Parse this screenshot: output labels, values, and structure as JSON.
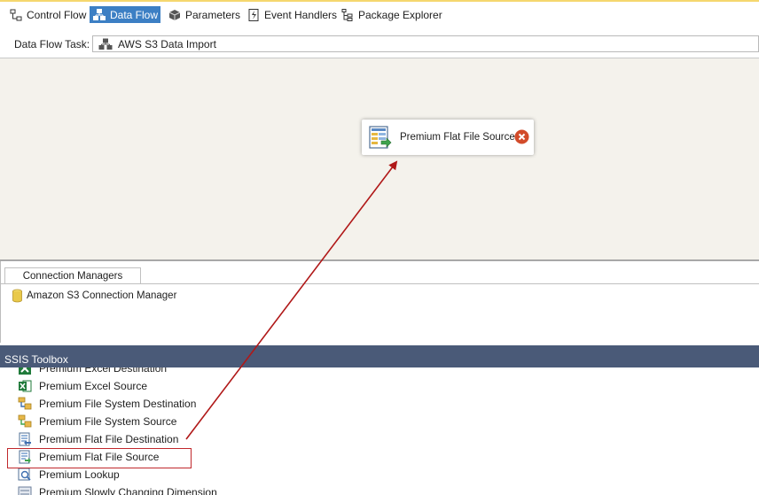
{
  "tabs": [
    {
      "label": "Control Flow",
      "icon": "control-flow-icon",
      "active": false
    },
    {
      "label": "Data Flow",
      "icon": "data-flow-icon",
      "active": true
    },
    {
      "label": "Parameters",
      "icon": "parameters-icon",
      "active": false
    },
    {
      "label": "Event Handlers",
      "icon": "event-handlers-icon",
      "active": false
    },
    {
      "label": "Package Explorer",
      "icon": "package-explorer-icon",
      "active": false
    }
  ],
  "task": {
    "label": "Data Flow Task:",
    "value": "AWS S3 Data Import"
  },
  "canvas": {
    "component_label": "Premium Flat File Source",
    "component_icon": "flat-file-source-icon",
    "error_icon": "error-icon"
  },
  "connection_managers": {
    "tab_label": "Connection Managers",
    "items": [
      "Amazon S3 Connection Manager"
    ]
  },
  "toolbox": {
    "title": "SSIS Toolbox",
    "items": [
      "Premium Excel Destination",
      "Premium Excel Source",
      "Premium File System Destination",
      "Premium File System Source",
      "Premium Flat File Destination",
      "Premium Flat File Source",
      "Premium Lookup",
      "Premium Slowly Changing Dimension"
    ],
    "highlighted": "Premium Flat File Source"
  },
  "colors": {
    "accent": "#3c7fc4",
    "toolbox_header": "#4a5a78",
    "canvas_bg": "#f4f2ec",
    "arrow": "#b01818"
  }
}
